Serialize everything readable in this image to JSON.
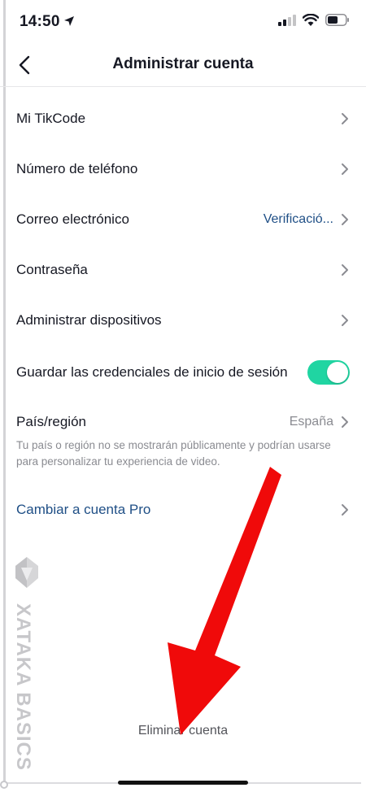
{
  "status_bar": {
    "time": "14:50"
  },
  "nav": {
    "title": "Administrar cuenta"
  },
  "rows": {
    "tikcode": {
      "label": "Mi TikCode"
    },
    "phone": {
      "label": "Número de teléfono"
    },
    "email": {
      "label": "Correo electrónico",
      "value": "Verificació..."
    },
    "password": {
      "label": "Contraseña"
    },
    "devices": {
      "label": "Administrar dispositivos"
    },
    "save_credentials": {
      "label": "Guardar las credenciales de inicio de sesión",
      "enabled": true
    },
    "region": {
      "label": "País/región",
      "value": "España",
      "note": "Tu país o región no se mostrarán públicamente y podrían usarse para personalizar tu experiencia de video."
    },
    "pro": {
      "label": "Cambiar a cuenta Pro"
    }
  },
  "delete_account": {
    "label": "Eliminar cuenta"
  },
  "watermark": {
    "text": "XATAKA BASICS"
  },
  "colors": {
    "accent_toggle": "#20d5a2",
    "link": "#1f4f86",
    "arrow": "#f00a0a"
  }
}
